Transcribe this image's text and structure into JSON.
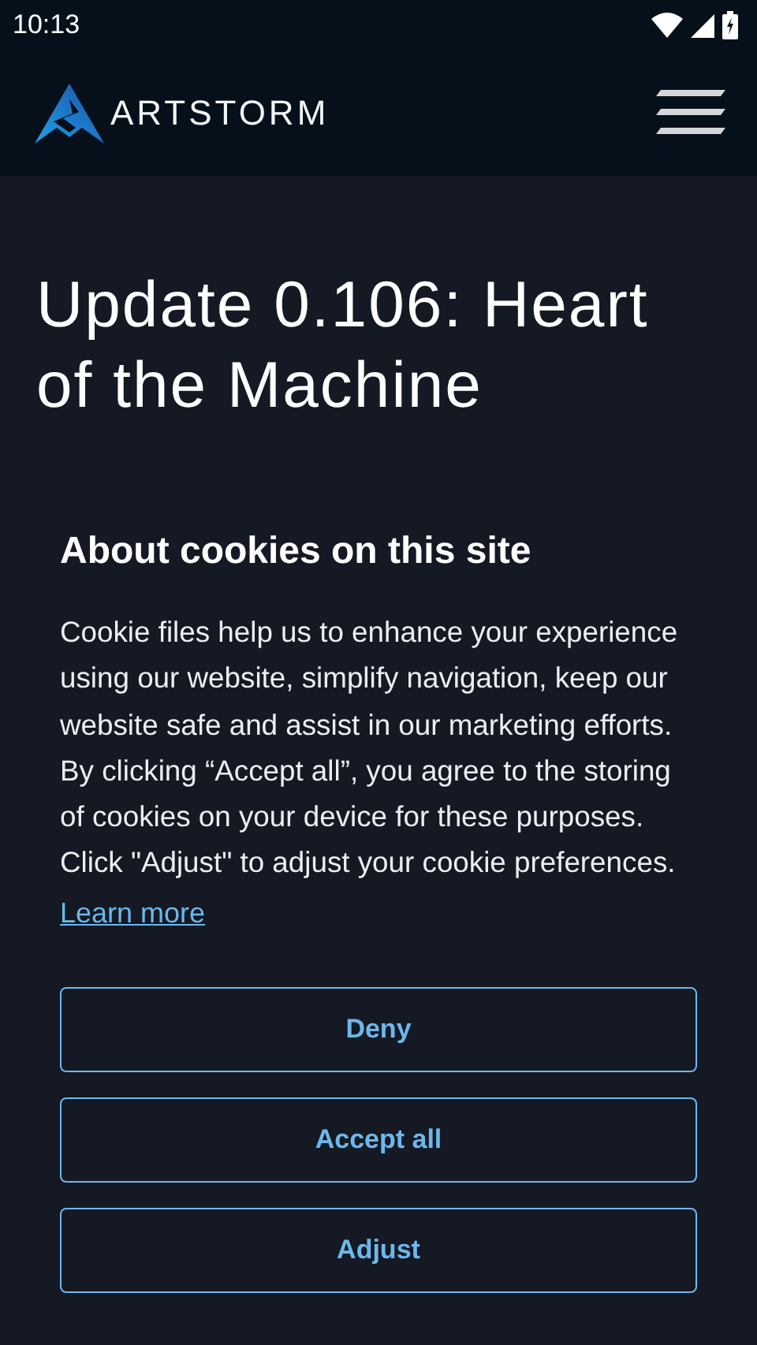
{
  "status_bar": {
    "time": "10:13"
  },
  "header": {
    "logo_text": "ARTSTORM"
  },
  "article": {
    "title": "Update 0.106: Heart of the Machine"
  },
  "cookie_banner": {
    "heading": "About cookies on this site",
    "body": "Cookie files help us to enhance your experience using our website, simplify navigation, keep our website safe and assist in our marketing efforts. By clicking “Accept all”, you agree to the storing of cookies on your device for these purposes. Click \"Adjust\" to adjust your cookie preferences.",
    "link": "Learn more",
    "buttons": [
      "Deny",
      "Accept all",
      "Adjust"
    ]
  }
}
